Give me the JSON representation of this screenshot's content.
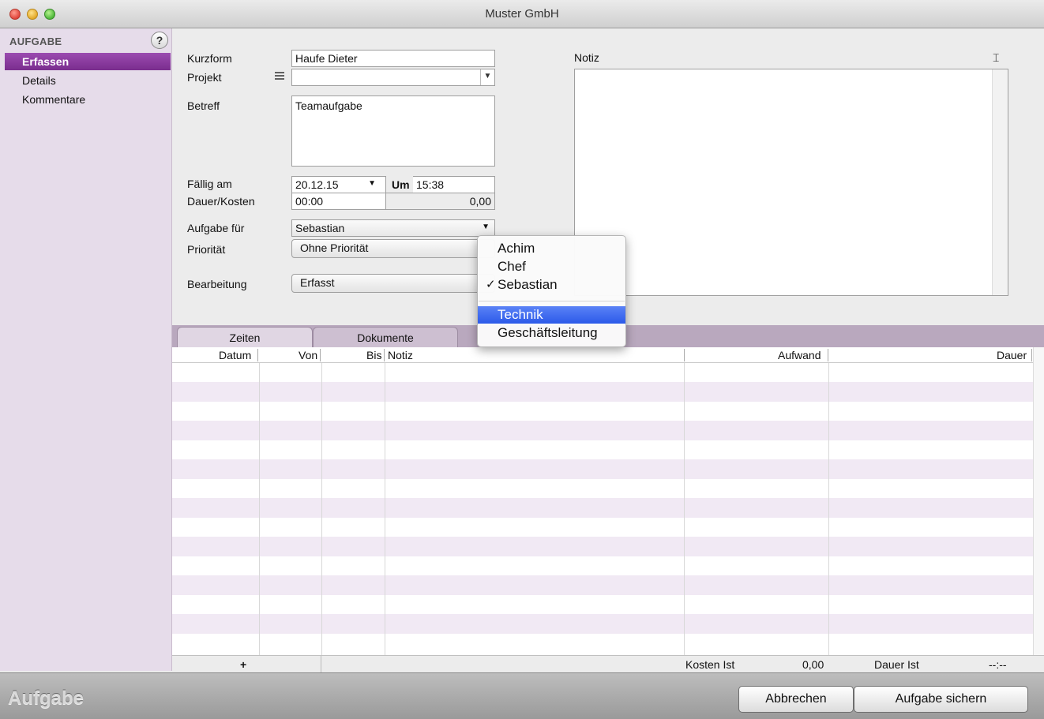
{
  "window": {
    "title": "Muster GmbH"
  },
  "sidebar": {
    "header": "AUFGABE",
    "help_label": "?",
    "items": [
      {
        "label": "Erfassen",
        "active": true
      },
      {
        "label": "Details",
        "active": false
      },
      {
        "label": "Kommentare",
        "active": false
      }
    ]
  },
  "form": {
    "kurzform_label": "Kurzform",
    "kurzform_value": "Haufe Dieter",
    "projekt_label": "Projekt",
    "projekt_value": "",
    "betreff_label": "Betreff",
    "betreff_value": "Teamaufgabe",
    "faellig_label": "Fällig am",
    "faellig_value": "20.12.15",
    "um_label": "Um",
    "um_value": "15:38",
    "dauer_label": "Dauer/Kosten",
    "dauer_value": "00:00",
    "kosten_value": "0,00",
    "aufgabe_fuer_label": "Aufgabe für",
    "aufgabe_fuer_value": "Sebastian",
    "prioritaet_label": "Priorität",
    "prioritaet_value": "Ohne Priorität",
    "bearbeitung_label": "Bearbeitung",
    "bearbeitung_value": "Erfasst",
    "notiz_label": "Notiz",
    "notiz_value": ""
  },
  "dropdown": {
    "items": [
      {
        "label": "Achim",
        "checked": false,
        "highlighted": false
      },
      {
        "label": "Chef",
        "checked": false,
        "highlighted": false
      },
      {
        "label": "Sebastian",
        "checked": true,
        "highlighted": false
      },
      {
        "label": "Technik",
        "checked": false,
        "highlighted": true
      },
      {
        "label": "Geschäftsleitung",
        "checked": false,
        "highlighted": false
      }
    ],
    "check_glyph": "✓"
  },
  "tabs": [
    {
      "label": "Zeiten",
      "active": true
    },
    {
      "label": "Dokumente",
      "active": false
    }
  ],
  "table": {
    "columns": [
      "Datum",
      "Von",
      "Bis",
      "Notiz",
      "Aufwand",
      "Dauer"
    ],
    "rows": []
  },
  "table_footer": {
    "add_label": "+",
    "kosten_ist_label": "Kosten Ist",
    "kosten_ist_value": "0,00",
    "dauer_ist_label": "Dauer Ist",
    "dauer_ist_value": "--:--"
  },
  "bottom": {
    "title": "Aufgabe",
    "cancel_label": "Abbrechen",
    "save_label": "Aufgabe sichern"
  },
  "colors": {
    "accent": "#7a2d8e",
    "sidebar_bg": "#e6dcea",
    "row_alt": "#f1e9f4",
    "menu_highlight": "#2c5ae9"
  }
}
